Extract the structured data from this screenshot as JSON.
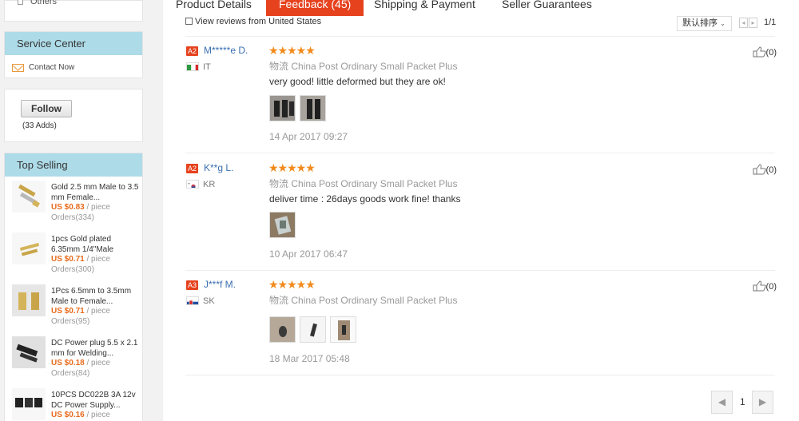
{
  "sidebar": {
    "others_label": "Others",
    "service": {
      "title": "Service Center",
      "contact": "Contact Now"
    },
    "follow": {
      "button": "Follow",
      "count": "(33 Adds)"
    },
    "top_selling": {
      "title": "Top Selling",
      "items": [
        {
          "name": "Gold 2.5 mm Male to 3.5 mm Female...",
          "price": "US $0.83",
          "unit": "/ piece",
          "orders": "Orders(334)"
        },
        {
          "name": "1pcs Gold plated 6.35mm 1/4\"Male",
          "price": "US $0.71",
          "unit": "/ piece",
          "orders": "Orders(300)"
        },
        {
          "name": "1Pcs 6.5mm to 3.5mm Male to Female...",
          "price": "US $0.71",
          "unit": "/ piece",
          "orders": "Orders(95)"
        },
        {
          "name": "DC Power plug 5.5 x 2.1 mm for Welding...",
          "price": "US $0.18",
          "unit": "/ piece",
          "orders": "Orders(84)"
        },
        {
          "name": "10PCS DC022B 3A 12v DC Power Supply...",
          "price": "US $0.16",
          "unit": "/ piece",
          "orders": ""
        }
      ]
    }
  },
  "tabs": {
    "product_details": "Product Details",
    "feedback": "Feedback (45)",
    "shipping": "Shipping & Payment",
    "seller_guarantees": "Seller Guarantees"
  },
  "filter": {
    "label": "View reviews from United States"
  },
  "sort": {
    "label": "默认排序"
  },
  "page_info": "1/1",
  "reviews": [
    {
      "level": "A2",
      "user": "M*****e D.",
      "country": "IT",
      "stars": "★★★★★",
      "logistics_prefix": "物流",
      "logistics": "China Post Ordinary Small Packet Plus",
      "comment": "very good! little deformed but they are ok!",
      "date": "14 Apr 2017 09:27",
      "helpful": "(0)"
    },
    {
      "level": "A2",
      "user": "K**g L.",
      "country": "KR",
      "stars": "★★★★★",
      "logistics_prefix": "物流",
      "logistics": "China Post Ordinary Small Packet Plus",
      "comment": "deliver time : 26days goods work fine! thanks",
      "date": "10 Apr 2017 06:47",
      "helpful": "(0)"
    },
    {
      "level": "A3",
      "user": "J***f M.",
      "country": "SK",
      "stars": "★★★★★",
      "logistics_prefix": "物流",
      "logistics": "China Post Ordinary Small Packet Plus",
      "comment": "",
      "date": "18 Mar 2017 05:48",
      "helpful": "(0)"
    }
  ],
  "pager": {
    "prev": "◀",
    "page": "1",
    "next": "▶"
  },
  "icons": {
    "thumb_up": "thumb-up-icon",
    "mail": "mail-icon",
    "chevron": "chevron-down-icon"
  },
  "colors": {
    "accent": "#e6421e",
    "stars": "#f28a1b",
    "price": "#e86b1c",
    "link": "#3a6fb0",
    "sidebar_head": "#aedbe8"
  }
}
